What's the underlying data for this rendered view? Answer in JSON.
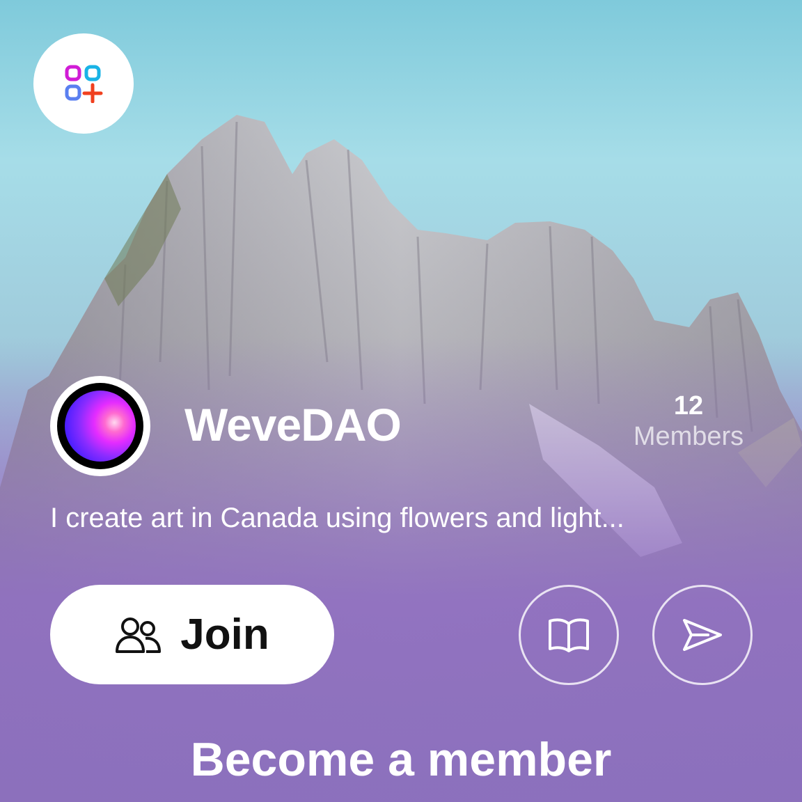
{
  "app": {
    "logo_icon": "dao-apps-plus-icon"
  },
  "dao": {
    "name": "WeveDAO",
    "member_count": "12",
    "member_label": "Members",
    "description": "I create art in Canada using flowers and light...",
    "avatar_icon": "gradient-orb-avatar"
  },
  "actions": {
    "join_label": "Join",
    "join_icon": "users-icon",
    "docs_icon": "book-icon",
    "share_icon": "send-icon"
  },
  "footer": {
    "cta_label": "Become a member"
  },
  "colors": {
    "accent_purple": "#8f72c0",
    "sky": "#a6dde8",
    "logo_magenta": "#d11cd6",
    "logo_cyan": "#19b3e6",
    "logo_blue": "#5a7ff0",
    "logo_red": "#f0401f"
  }
}
